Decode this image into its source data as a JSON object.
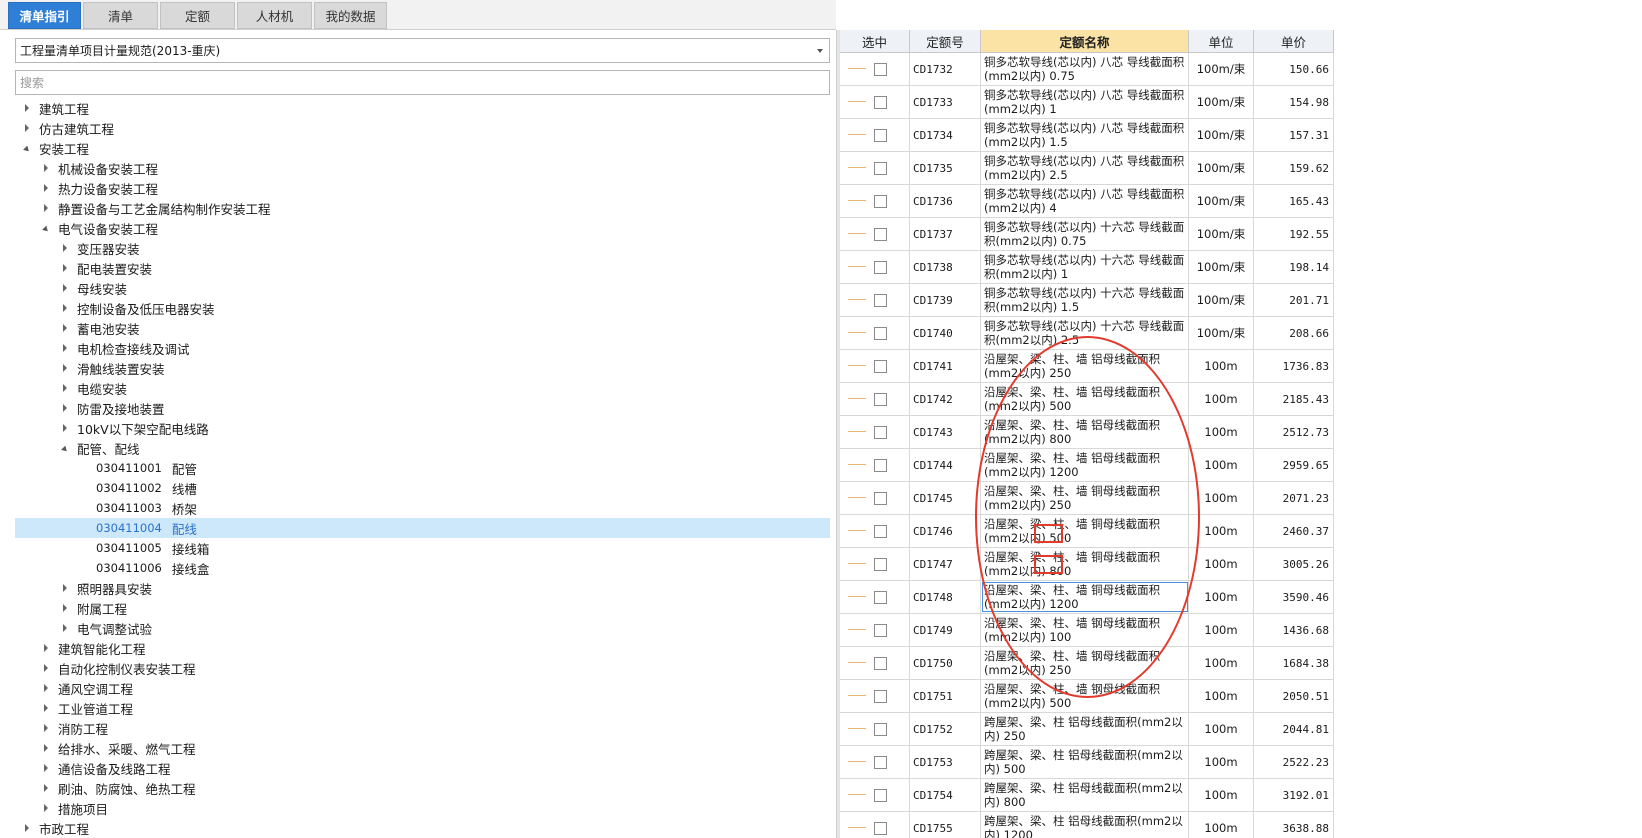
{
  "tabs": [
    {
      "label": "清单指引",
      "active": true
    },
    {
      "label": "清单",
      "active": false
    },
    {
      "label": "定额",
      "active": false
    },
    {
      "label": "人材机",
      "active": false
    },
    {
      "label": "我的数据",
      "active": false
    }
  ],
  "left_panel": {
    "spec_select": "工程量清单项目计量规范(2013-重庆)",
    "search_placeholder": "搜索",
    "tree": [
      {
        "label": "建筑工程",
        "code": "",
        "level": 0,
        "state": "collapsed"
      },
      {
        "label": "仿古建筑工程",
        "code": "",
        "level": 0,
        "state": "collapsed"
      },
      {
        "label": "安装工程",
        "code": "",
        "level": 0,
        "state": "expanded"
      },
      {
        "label": "机械设备安装工程",
        "code": "",
        "level": 1,
        "state": "collapsed"
      },
      {
        "label": "热力设备安装工程",
        "code": "",
        "level": 1,
        "state": "collapsed"
      },
      {
        "label": "静置设备与工艺金属结构制作安装工程",
        "code": "",
        "level": 1,
        "state": "collapsed"
      },
      {
        "label": "电气设备安装工程",
        "code": "",
        "level": 1,
        "state": "expanded"
      },
      {
        "label": "变压器安装",
        "code": "",
        "level": 2,
        "state": "collapsed"
      },
      {
        "label": "配电装置安装",
        "code": "",
        "level": 2,
        "state": "collapsed"
      },
      {
        "label": "母线安装",
        "code": "",
        "level": 2,
        "state": "collapsed"
      },
      {
        "label": "控制设备及低压电器安装",
        "code": "",
        "level": 2,
        "state": "collapsed"
      },
      {
        "label": "蓄电池安装",
        "code": "",
        "level": 2,
        "state": "collapsed"
      },
      {
        "label": "电机检查接线及调试",
        "code": "",
        "level": 2,
        "state": "collapsed"
      },
      {
        "label": "滑触线装置安装",
        "code": "",
        "level": 2,
        "state": "collapsed"
      },
      {
        "label": "电缆安装",
        "code": "",
        "level": 2,
        "state": "collapsed"
      },
      {
        "label": "防雷及接地装置",
        "code": "",
        "level": 2,
        "state": "collapsed"
      },
      {
        "label": "10kV以下架空配电线路",
        "code": "",
        "level": 2,
        "state": "collapsed"
      },
      {
        "label": "配管、配线",
        "code": "",
        "level": 2,
        "state": "expanded"
      },
      {
        "label": "配管",
        "code": "030411001",
        "level": 3,
        "state": "none"
      },
      {
        "label": "线槽",
        "code": "030411002",
        "level": 3,
        "state": "none"
      },
      {
        "label": "桥架",
        "code": "030411003",
        "level": 3,
        "state": "none"
      },
      {
        "label": "配线",
        "code": "030411004",
        "level": 3,
        "state": "none",
        "selected": true
      },
      {
        "label": "接线箱",
        "code": "030411005",
        "level": 3,
        "state": "none"
      },
      {
        "label": "接线盒",
        "code": "030411006",
        "level": 3,
        "state": "none"
      },
      {
        "label": "照明器具安装",
        "code": "",
        "level": 2,
        "state": "collapsed"
      },
      {
        "label": "附属工程",
        "code": "",
        "level": 2,
        "state": "collapsed"
      },
      {
        "label": "电气调整试验",
        "code": "",
        "level": 2,
        "state": "collapsed"
      },
      {
        "label": "建筑智能化工程",
        "code": "",
        "level": 1,
        "state": "collapsed"
      },
      {
        "label": "自动化控制仪表安装工程",
        "code": "",
        "level": 1,
        "state": "collapsed"
      },
      {
        "label": "通风空调工程",
        "code": "",
        "level": 1,
        "state": "collapsed"
      },
      {
        "label": "工业管道工程",
        "code": "",
        "level": 1,
        "state": "collapsed"
      },
      {
        "label": "消防工程",
        "code": "",
        "level": 1,
        "state": "collapsed"
      },
      {
        "label": "给排水、采暖、燃气工程",
        "code": "",
        "level": 1,
        "state": "collapsed"
      },
      {
        "label": "通信设备及线路工程",
        "code": "",
        "level": 1,
        "state": "collapsed"
      },
      {
        "label": "刷油、防腐蚀、绝热工程",
        "code": "",
        "level": 1,
        "state": "collapsed"
      },
      {
        "label": "措施项目",
        "code": "",
        "level": 1,
        "state": "collapsed"
      },
      {
        "label": "市政工程",
        "code": "",
        "level": 0,
        "state": "collapsed"
      }
    ]
  },
  "grid": {
    "columns": [
      "选中",
      "定额号",
      "定额名称",
      "单位",
      "单价"
    ],
    "rows": [
      {
        "code": "CD1732",
        "name": "铜多芯软导线(芯以内) 八芯 导线截面积(mm2以内) 0.75",
        "unit": "100m/束",
        "price": "150.66"
      },
      {
        "code": "CD1733",
        "name": "铜多芯软导线(芯以内) 八芯 导线截面积(mm2以内) 1",
        "unit": "100m/束",
        "price": "154.98"
      },
      {
        "code": "CD1734",
        "name": "铜多芯软导线(芯以内) 八芯 导线截面积(mm2以内) 1.5",
        "unit": "100m/束",
        "price": "157.31"
      },
      {
        "code": "CD1735",
        "name": "铜多芯软导线(芯以内) 八芯 导线截面积(mm2以内) 2.5",
        "unit": "100m/束",
        "price": "159.62"
      },
      {
        "code": "CD1736",
        "name": "铜多芯软导线(芯以内) 八芯 导线截面积(mm2以内) 4",
        "unit": "100m/束",
        "price": "165.43"
      },
      {
        "code": "CD1737",
        "name": "铜多芯软导线(芯以内) 十六芯 导线截面积(mm2以内) 0.75",
        "unit": "100m/束",
        "price": "192.55"
      },
      {
        "code": "CD1738",
        "name": "铜多芯软导线(芯以内) 十六芯 导线截面积(mm2以内) 1",
        "unit": "100m/束",
        "price": "198.14"
      },
      {
        "code": "CD1739",
        "name": "铜多芯软导线(芯以内) 十六芯 导线截面积(mm2以内) 1.5",
        "unit": "100m/束",
        "price": "201.71"
      },
      {
        "code": "CD1740",
        "name": "铜多芯软导线(芯以内) 十六芯 导线截面积(mm2以内) 2.5",
        "unit": "100m/束",
        "price": "208.66"
      },
      {
        "code": "CD1741",
        "name": "沿屋架、梁、柱、墙 铝母线截面积(mm2以内) 250",
        "unit": "100m",
        "price": "1736.83"
      },
      {
        "code": "CD1742",
        "name": "沿屋架、梁、柱、墙 铝母线截面积(mm2以内) 500",
        "unit": "100m",
        "price": "2185.43"
      },
      {
        "code": "CD1743",
        "name": "沿屋架、梁、柱、墙 铝母线截面积(mm2以内) 800",
        "unit": "100m",
        "price": "2512.73"
      },
      {
        "code": "CD1744",
        "name": "沿屋架、梁、柱、墙 铝母线截面积(mm2以内) 1200",
        "unit": "100m",
        "price": "2959.65"
      },
      {
        "code": "CD1745",
        "name": "沿屋架、梁、柱、墙 铜母线截面积(mm2以内) 250",
        "unit": "100m",
        "price": "2071.23"
      },
      {
        "code": "CD1746",
        "name": "沿屋架、梁、柱、墙 铜母线截面积(mm2以内) 500",
        "unit": "100m",
        "price": "2460.37"
      },
      {
        "code": "CD1747",
        "name": "沿屋架、梁、柱、墙 铜母线截面积(mm2以内) 800",
        "unit": "100m",
        "price": "3005.26"
      },
      {
        "code": "CD1748",
        "name": "沿屋架、梁、柱、墙 铜母线截面积(mm2以内) 1200",
        "unit": "100m",
        "price": "3590.46",
        "focused": true
      },
      {
        "code": "CD1749",
        "name": "沿屋架、梁、柱、墙 钢母线截面积(mm2以内) 100",
        "unit": "100m",
        "price": "1436.68"
      },
      {
        "code": "CD1750",
        "name": "沿屋架、梁、柱、墙 钢母线截面积(mm2以内) 250",
        "unit": "100m",
        "price": "1684.38"
      },
      {
        "code": "CD1751",
        "name": "沿屋架、梁、柱、墙 钢母线截面积(mm2以内) 500",
        "unit": "100m",
        "price": "2050.51"
      },
      {
        "code": "CD1752",
        "name": "跨屋架、梁、柱 铝母线截面积(mm2以内) 250",
        "unit": "100m",
        "price": "2044.81"
      },
      {
        "code": "CD1753",
        "name": "跨屋架、梁、柱 铝母线截面积(mm2以内) 500",
        "unit": "100m",
        "price": "2522.23"
      },
      {
        "code": "CD1754",
        "name": "跨屋架、梁、柱 铝母线截面积(mm2以内) 800",
        "unit": "100m",
        "price": "3192.01"
      },
      {
        "code": "CD1755",
        "name": "跨屋架、梁、柱 铝母线截面积(mm2以内) 1200",
        "unit": "100m",
        "price": "3638.88"
      }
    ]
  },
  "colors": {
    "tab_active": "#2f7fd6",
    "name_header": "#fbe3a6",
    "selection": "#cde8fa",
    "annotation": "#e23b2e"
  }
}
